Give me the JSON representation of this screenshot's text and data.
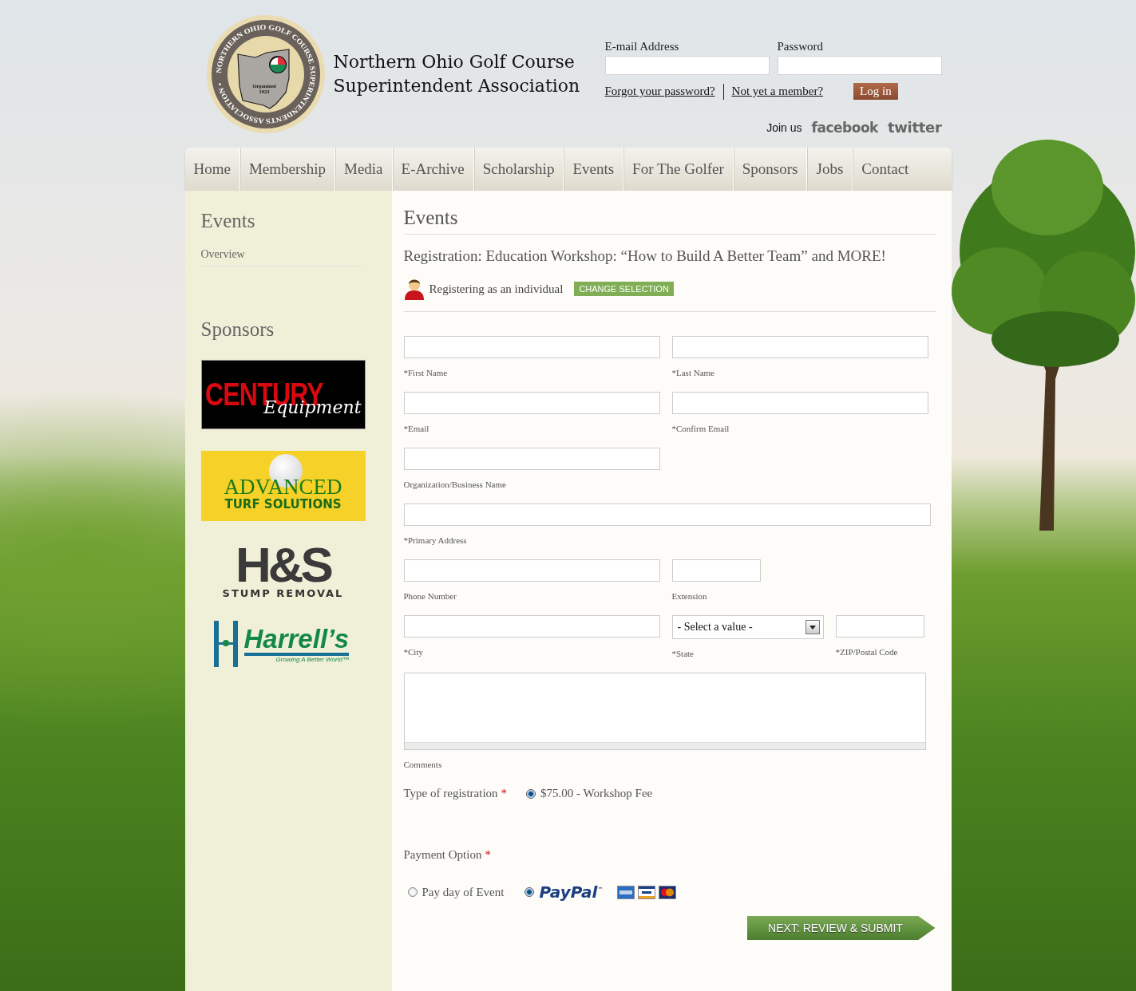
{
  "header": {
    "seal": {
      "ring_text": "NORTHERN OHIO GOLF COURSE SUPERINTENDENTS ASSOCIATION •",
      "organized": "Organized",
      "year": "1923"
    },
    "title_lines": [
      "Northern Ohio Golf Course",
      "Superintendent Association"
    ]
  },
  "login": {
    "email_label": "E-mail Address",
    "password_label": "Password",
    "forgot_link": "Forgot your password?",
    "member_link": "Not yet a member?",
    "login_button": "Log in"
  },
  "social": {
    "join_label": "Join us",
    "links": [
      {
        "kind": "facebook",
        "label": "facebook"
      },
      {
        "kind": "twitter",
        "label": "twitter"
      }
    ]
  },
  "nav": [
    "Home",
    "Membership",
    "Media",
    "E-Archive",
    "Scholarship",
    "Events",
    "For The Golfer",
    "Sponsors",
    "Jobs",
    "Contact"
  ],
  "sidebar": {
    "title": "Events",
    "items": [
      "Overview"
    ],
    "sponsors_title": "Sponsors",
    "sponsors": [
      {
        "kind": "century",
        "name": "CENTURY",
        "tagline": "Equipment"
      },
      {
        "kind": "advanced",
        "name": "ADVANCED",
        "tagline": "TURF SOLUTIONS"
      },
      {
        "kind": "hs",
        "name": "H&S",
        "tagline": "STUMP REMOVAL"
      },
      {
        "kind": "harrells",
        "name": "Harrell’s",
        "tagline": "Growing A Better World™"
      }
    ]
  },
  "main": {
    "title": "Events",
    "heading": "Registration:  Education Workshop: “How to Build A Better Team” and MORE!",
    "registrant": {
      "text": "Registering as an individual",
      "button": "CHANGE SELECTION"
    },
    "field_rows": [
      [
        {
          "kind": "half",
          "label": "*First Name"
        },
        {
          "kind": "half",
          "label": "*Last Name"
        }
      ],
      [
        {
          "kind": "half",
          "label": "*Email"
        },
        {
          "kind": "half",
          "label": "*Confirm Email"
        }
      ],
      [
        {
          "kind": "half",
          "label": "Organization/Business Name"
        }
      ],
      [
        {
          "kind": "wide",
          "label": "*Primary Address"
        }
      ],
      [
        {
          "kind": "half",
          "label": "Phone Number"
        },
        {
          "kind": "short",
          "label": "Extension"
        }
      ],
      [
        {
          "kind": "half",
          "label": "*City"
        },
        {
          "kind": "select",
          "label": "*State",
          "value": "- Select a value -"
        },
        {
          "kind": "short",
          "label": "*ZIP/Postal Code"
        }
      ],
      [
        {
          "kind": "textarea",
          "label": "Comments"
        }
      ]
    ],
    "registration_type": {
      "label": "Type of registration",
      "marker": "*",
      "options": [
        {
          "label": "$75.00 - Workshop Fee",
          "selected": true
        }
      ]
    },
    "payment": {
      "label": "Payment Option",
      "marker": "*",
      "options": [
        {
          "kind": "text",
          "label": "Pay day of Event",
          "selected": false
        },
        {
          "kind": "paypal",
          "label": "PayPal",
          "tm": "™",
          "selected": true
        }
      ]
    },
    "submit": "NEXT: REVIEW & SUBMIT"
  }
}
